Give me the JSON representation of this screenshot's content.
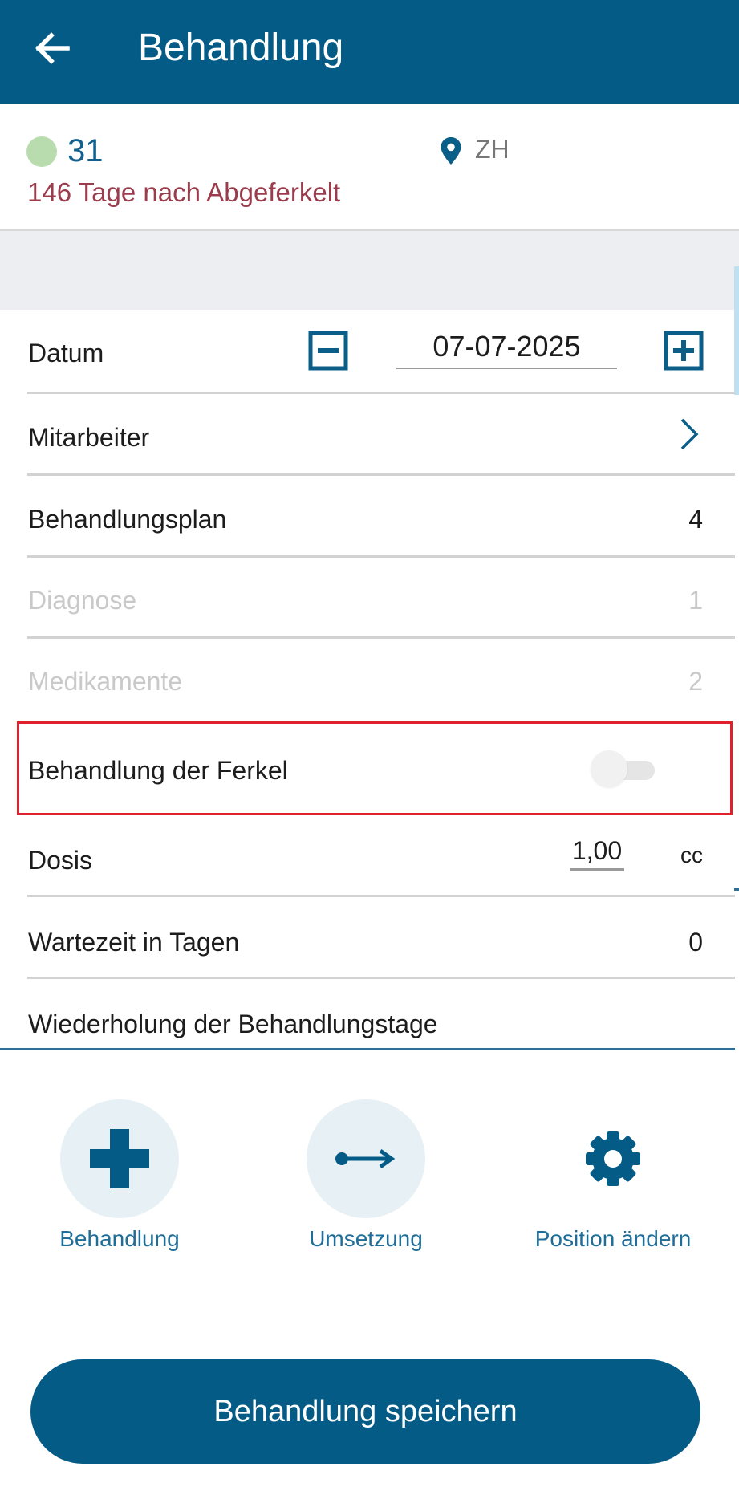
{
  "header": {
    "title": "Behandlung",
    "back_icon": "arrow-left-icon"
  },
  "animal": {
    "number": "31",
    "status_color": "#b9dcae",
    "location": "ZH",
    "days_text": "146 Tage nach Abgeferkelt"
  },
  "form": {
    "date": {
      "label": "Datum",
      "value": "07-07-2025"
    },
    "employee": {
      "label": "Mitarbeiter"
    },
    "plan": {
      "label": "Behandlungsplan",
      "value": "4"
    },
    "diagnosis": {
      "label": "Diagnose",
      "value": "1",
      "enabled": false
    },
    "medication": {
      "label": "Medikamente",
      "value": "2",
      "enabled": false
    },
    "piglets": {
      "label": "Behandlung der Ferkel",
      "toggle_on": false
    },
    "dose": {
      "label": "Dosis",
      "value": "1,00",
      "unit": "cc"
    },
    "waiting": {
      "label": "Wartezeit in Tagen",
      "value": "0"
    },
    "repeat": {
      "label": "Wiederholung der Behandlungstage"
    }
  },
  "actions": [
    {
      "label": "Behandlung",
      "icon": "plus-icon"
    },
    {
      "label": "Umsetzung",
      "icon": "arrow-right-icon"
    },
    {
      "label": "Position ändern",
      "icon": "gear-icon"
    }
  ],
  "footer": {
    "save_label": "Behandlung speichern"
  },
  "colors": {
    "primary": "#035b86",
    "highlight": "#e0202c",
    "accent_text": "#1f6d99",
    "warning_text": "#9b3c4c"
  }
}
